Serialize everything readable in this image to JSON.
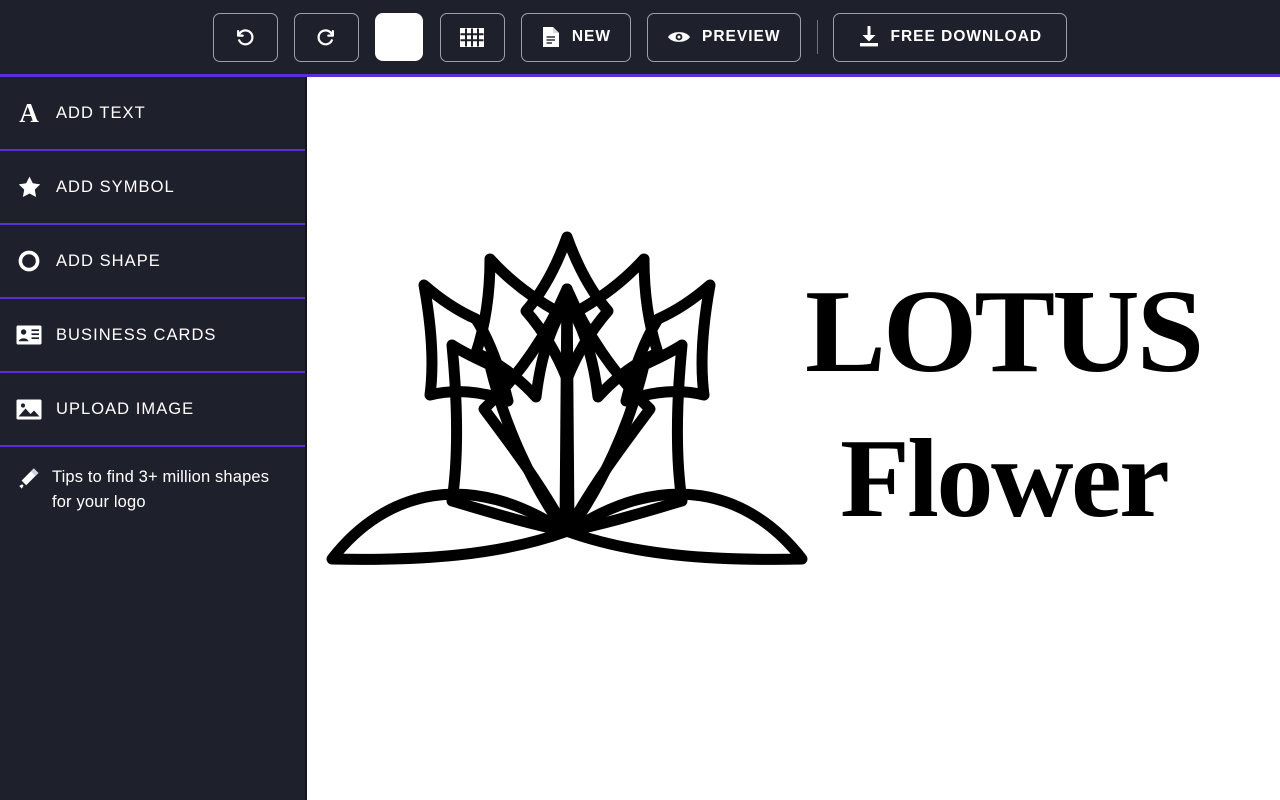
{
  "app": {
    "background_dark": "#1e212b",
    "accent_purple": "#5b2fd6",
    "canvas_background": "#ffffff"
  },
  "toolbar": {
    "undo": {
      "name": "undo-button",
      "icon": "undo-icon",
      "label": ""
    },
    "redo": {
      "name": "redo-button",
      "icon": "redo-icon",
      "label": ""
    },
    "color_swatch": {
      "name": "background-color-swatch",
      "color": "#ffffff"
    },
    "grid": {
      "name": "grid-button",
      "icon": "grid-icon"
    },
    "new": {
      "label": "NEW",
      "icon": "document-icon"
    },
    "preview": {
      "label": "PREVIEW",
      "icon": "eye-icon"
    },
    "download": {
      "label": "FREE DOWNLOAD",
      "icon": "download-icon"
    }
  },
  "sidebar": {
    "items": [
      {
        "label": "ADD TEXT",
        "icon": "text-a-icon"
      },
      {
        "label": "ADD SYMBOL",
        "icon": "star-icon"
      },
      {
        "label": "ADD SHAPE",
        "icon": "circle-icon"
      },
      {
        "label": "BUSINESS CARDS",
        "icon": "id-card-icon"
      },
      {
        "label": "UPLOAD IMAGE",
        "icon": "image-icon"
      }
    ],
    "tips": {
      "text": "Tips to find 3+ million shapes for your logo",
      "icon": "magic-wand-icon"
    }
  },
  "canvas": {
    "logo": {
      "symbol": "lotus-flower-outline",
      "title": "LOTUS",
      "subtitle": "Flower",
      "ink_color": "#000000"
    }
  }
}
